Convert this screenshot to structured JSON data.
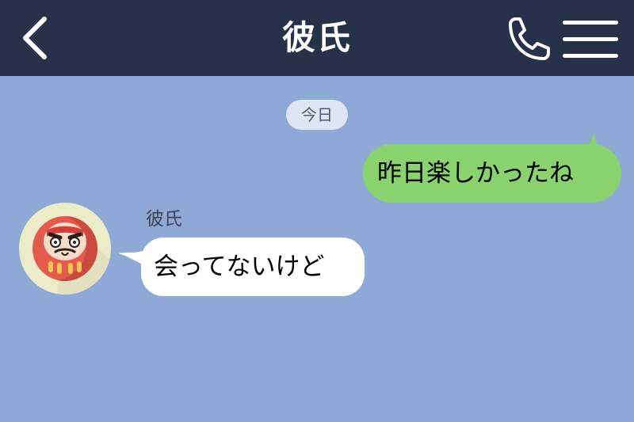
{
  "header": {
    "title": "彼氏",
    "back_icon": "chevron-left-icon",
    "call_icon": "phone-icon",
    "menu_icon": "hamburger-menu-icon"
  },
  "chat": {
    "date_label": "今日",
    "sent_message": "昨日楽しかったね",
    "sender_name": "彼氏",
    "received_message": "会ってないけど",
    "avatar_icon": "daruma-icon"
  },
  "colors": {
    "header_bg": "#27314a",
    "chat_bg": "#8fa9d6",
    "sent_bubble": "#8ad26d",
    "received_bubble": "#ffffff",
    "date_pill_bg": "#dde6f3"
  }
}
